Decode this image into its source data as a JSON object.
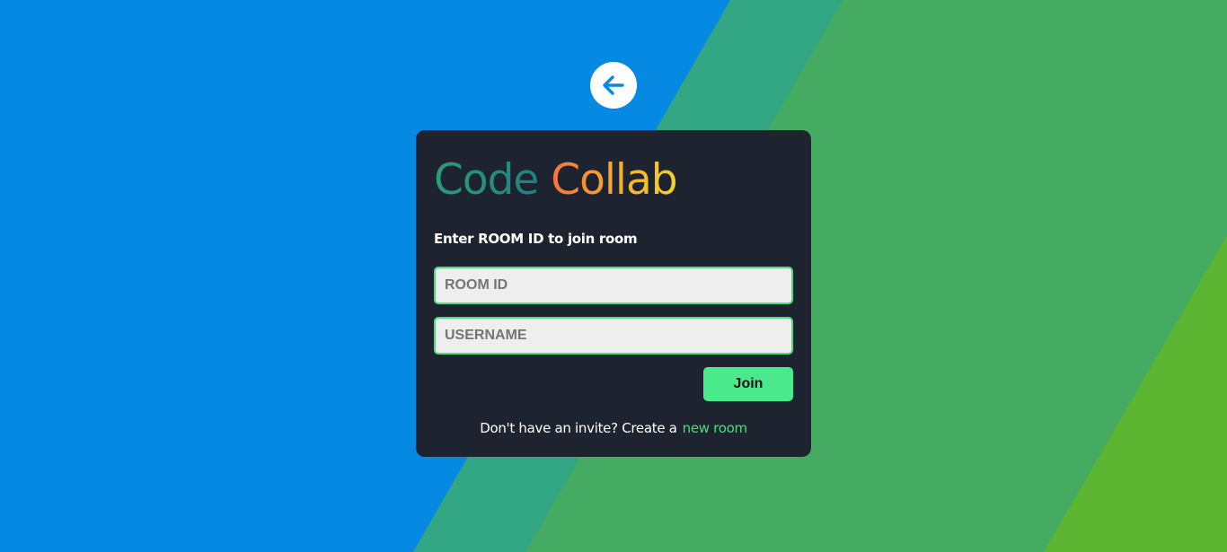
{
  "colors": {
    "background_blue": "#0589e3",
    "background_teal": "#33a684",
    "background_green": "#45aa62",
    "background_lime": "#5cb530",
    "card": "#1e2330",
    "accent": "#4ade80",
    "back_arrow": "#0589e3"
  },
  "back_button": {
    "icon": "arrow-left-icon"
  },
  "card": {
    "logo": {
      "part1": "Code",
      "part2": "Collab"
    },
    "subtitle": "Enter ROOM ID to join room",
    "room_id": {
      "placeholder": "ROOM ID",
      "value": ""
    },
    "username": {
      "placeholder": "USERNAME",
      "value": ""
    },
    "join_label": "Join",
    "invite_text": "Don't have an invite? Create a",
    "invite_link": "new room"
  }
}
